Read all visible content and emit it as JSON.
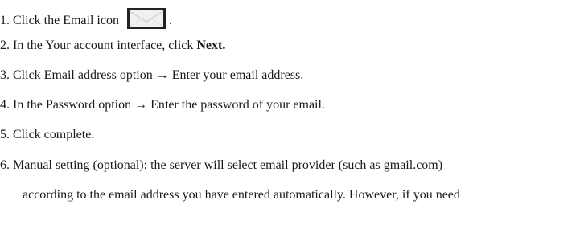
{
  "steps": [
    {
      "number": "1.",
      "before": "Click the Email icon",
      "icon": "envelope-icon",
      "after": "."
    },
    {
      "number": "2.",
      "before": "In the Your account interface, click ",
      "bold": "Next."
    },
    {
      "number": "3.",
      "text": "Click Email address option → Enter your email address."
    },
    {
      "number": "4.",
      "text": "In the Password option → Enter the password of your email."
    },
    {
      "number": "5.",
      "text": "Click complete."
    },
    {
      "number": "6.",
      "text": "Manual setting (optional): the server will select email provider (such as gmail.com)",
      "continuation": "according to the email address you have entered automatically. However, if you need"
    }
  ],
  "colors": {
    "text": "#1a1a1a",
    "icon_border": "#222222",
    "icon_fill": "#f1f1f1"
  }
}
